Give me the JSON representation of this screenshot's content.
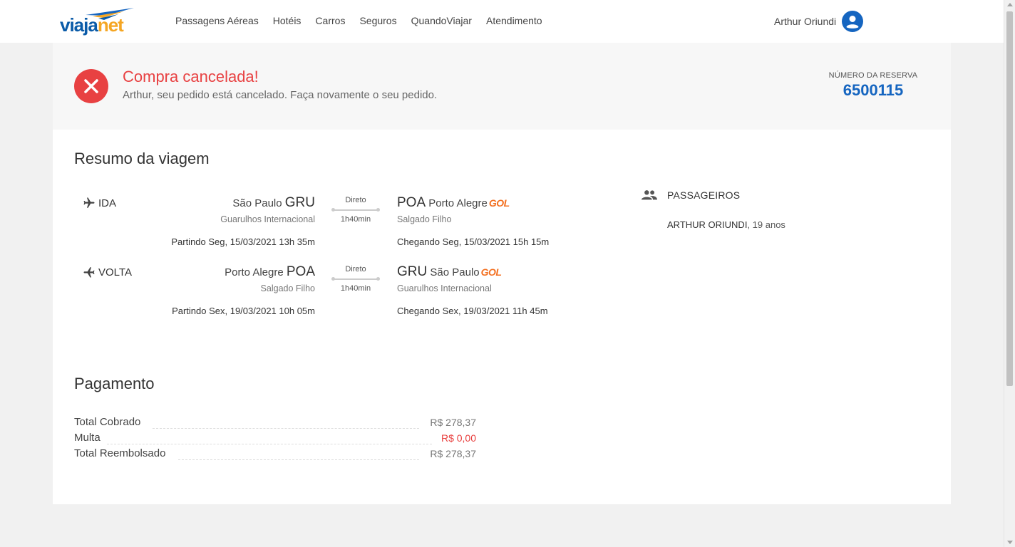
{
  "brand": {
    "name_a": "viaja",
    "name_b": "net",
    "primary": "#0a5ba8",
    "accent": "#f5a623"
  },
  "nav": {
    "items": [
      "Passagens Aéreas",
      "Hotéis",
      "Carros",
      "Seguros",
      "QuandoViajar",
      "Atendimento"
    ]
  },
  "user": {
    "name": "Arthur Oriundi",
    "icon": "user-avatar-icon"
  },
  "status": {
    "title": "Compra cancelada!",
    "message": "Arthur, seu pedido está cancelado. Faça novamente o seu pedido.",
    "reservation_label": "NÚMERO DA RESERVA",
    "reservation_number": "6500115",
    "color": "#e84142"
  },
  "trip": {
    "title": "Resumo da viagem",
    "legs": [
      {
        "label": "IDA",
        "icon": "airplane-departure-icon",
        "origin": {
          "city": "São Paulo",
          "code": "GRU",
          "airport": "Guarulhos Internacional",
          "time": "Partindo Seg, 15/03/2021 13h 35m"
        },
        "stops": "Direto",
        "duration": "1h40min",
        "destination": {
          "city": "Porto Alegre",
          "code": "POA",
          "airport": "Salgado Filho",
          "time": "Chegando Seg, 15/03/2021 15h 15m"
        },
        "airline": "GOL"
      },
      {
        "label": "VOLTA",
        "icon": "airplane-return-icon",
        "origin": {
          "city": "Porto Alegre",
          "code": "POA",
          "airport": "Salgado Filho",
          "time": "Partindo Sex, 19/03/2021 10h 05m"
        },
        "stops": "Direto",
        "duration": "1h40min",
        "destination": {
          "city": "São Paulo",
          "code": "GRU",
          "airport": "Guarulhos Internacional",
          "time": "Chegando Sex, 19/03/2021 11h 45m"
        },
        "airline": "GOL"
      }
    ]
  },
  "passengers": {
    "title": "PASSAGEIROS",
    "list": [
      {
        "name": "ARTHUR ORIUNDI",
        "age": ", 19 anos"
      }
    ]
  },
  "payment": {
    "title": "Pagamento",
    "rows": [
      {
        "label": "Total Cobrado",
        "value": "R$ 278,37"
      },
      {
        "label": "Multa",
        "value": "R$ 0,00",
        "color": "#e8403f"
      },
      {
        "label": "Total Reembolsado",
        "value": "R$ 278,37"
      }
    ]
  }
}
